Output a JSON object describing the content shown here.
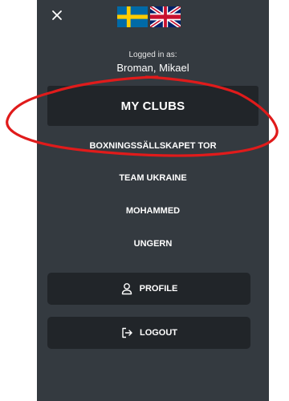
{
  "drawer": {
    "login_label": "Logged in as:",
    "user_name": "Broman, Mikael",
    "clubs_header": "MY CLUBS",
    "clubs": [
      {
        "label": "BOXNINGSSÄLLSKAPET TOR"
      },
      {
        "label": "TEAM UKRAINE"
      },
      {
        "label": "MOHAMMED"
      },
      {
        "label": "UNGERN"
      }
    ],
    "profile_label": "PROFILE",
    "logout_label": "LOGOUT"
  },
  "icons": {
    "close": "close-icon",
    "swedish_flag": "swedish-flag-icon",
    "uk_flag": "uk-flag-icon",
    "profile": "user-icon",
    "logout": "logout-icon"
  },
  "colors": {
    "drawer_bg": "#343a40",
    "button_bg": "#212529",
    "annotation_red": "#e01b1b"
  }
}
